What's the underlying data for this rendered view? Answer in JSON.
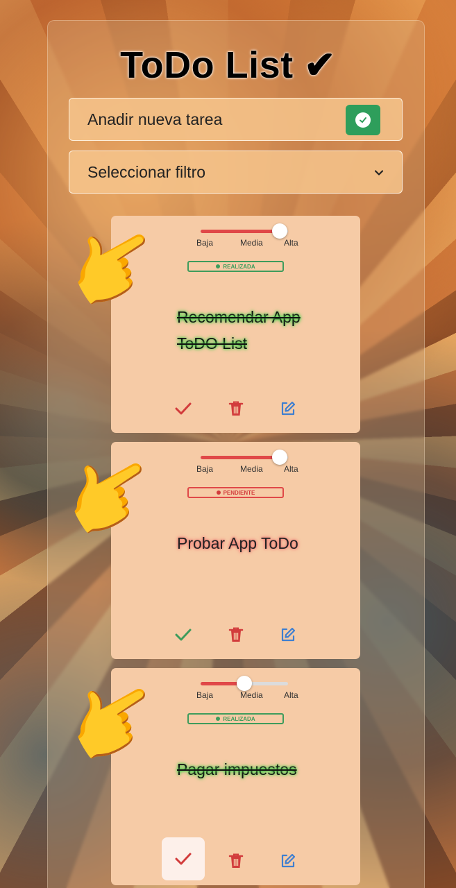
{
  "app": {
    "title": "ToDo List ✔"
  },
  "add_task": {
    "placeholder": "Anadir nueva tarea",
    "button_icon": "check-circle-icon",
    "button_color": "#2e9e5b"
  },
  "filter": {
    "selected": "Seleccionar filtro",
    "icon": "chevron-down-icon"
  },
  "priority_labels": [
    "Baja",
    "Media",
    "Alta"
  ],
  "tasks": [
    {
      "text": "Recomendar App ToDO List",
      "status": "REALIZADA",
      "done": true,
      "priority_value": 1.0
    },
    {
      "text": "Probar App ToDo",
      "status": "PENDIENTE",
      "done": false,
      "priority_value": 1.0
    },
    {
      "text": "Pagar impuestos",
      "status": "REALIZADA",
      "done": true,
      "priority_value": 0.5
    }
  ],
  "colors": {
    "done": "#3e9c5c",
    "pending": "#d23c3c",
    "edit": "#3f7fd0",
    "card": "#f6cba6"
  }
}
